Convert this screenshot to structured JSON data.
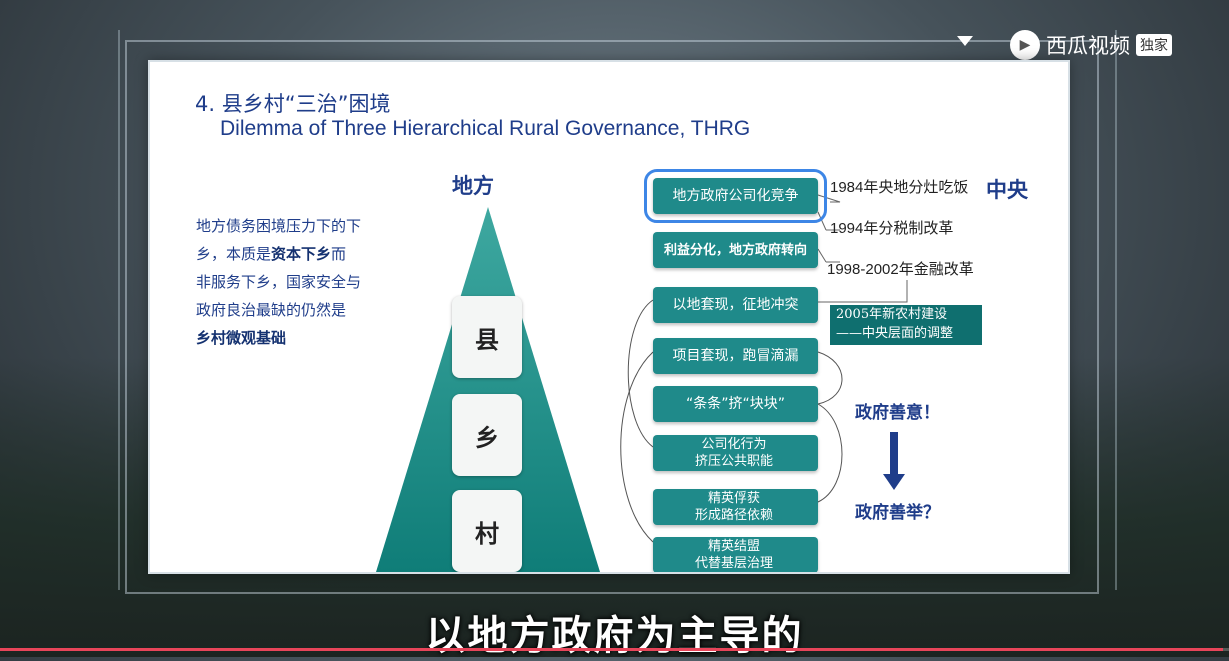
{
  "player": {
    "logo_text": "西瓜视频",
    "logo_badge": "独家",
    "logo_mark": "▶",
    "subtitle": "以地方政府为主导的",
    "progress_fraction": 0.995
  },
  "slide": {
    "title_cn": "4. 县乡村“三治”困境",
    "title_en": "Dilemma of Three Hierarchical Rural Governance, THRG",
    "left_text": {
      "part1": "地方债务困境压力下的下乡，本质是",
      "bold1": "资本下乡",
      "part2": "而非服务下乡，国家安全与政府良治最缺的仍然是",
      "bold2": "乡村微观基础"
    },
    "label_local": "地方",
    "label_central": "中央",
    "pyramid_tiers": [
      "县",
      "乡",
      "村"
    ],
    "boxes": [
      "地方政府公司化竞争",
      "利益分化，地方政府转向",
      "以地套现，征地冲突",
      "项目套现，跑冒滴漏",
      "“条条”挤“块块”",
      "公司化行为\n挤压公共职能",
      "精英俘获\n形成路径依赖",
      "精英结盟\n代替基层治理"
    ],
    "annotations": {
      "a1984": "1984年央地分灶吃饭",
      "a1994": "1994年分税制改革",
      "a1998": "1998-2002年金融改革",
      "rural_line1": "2005年新农村建设",
      "rural_line2": "——中央层面的调整"
    },
    "goodwill": "政府善意！",
    "goodact": "政府善举？"
  },
  "colors": {
    "teal": "#1f8a8a",
    "navy": "#1f3d8a",
    "highlight": "#3d86e6"
  }
}
